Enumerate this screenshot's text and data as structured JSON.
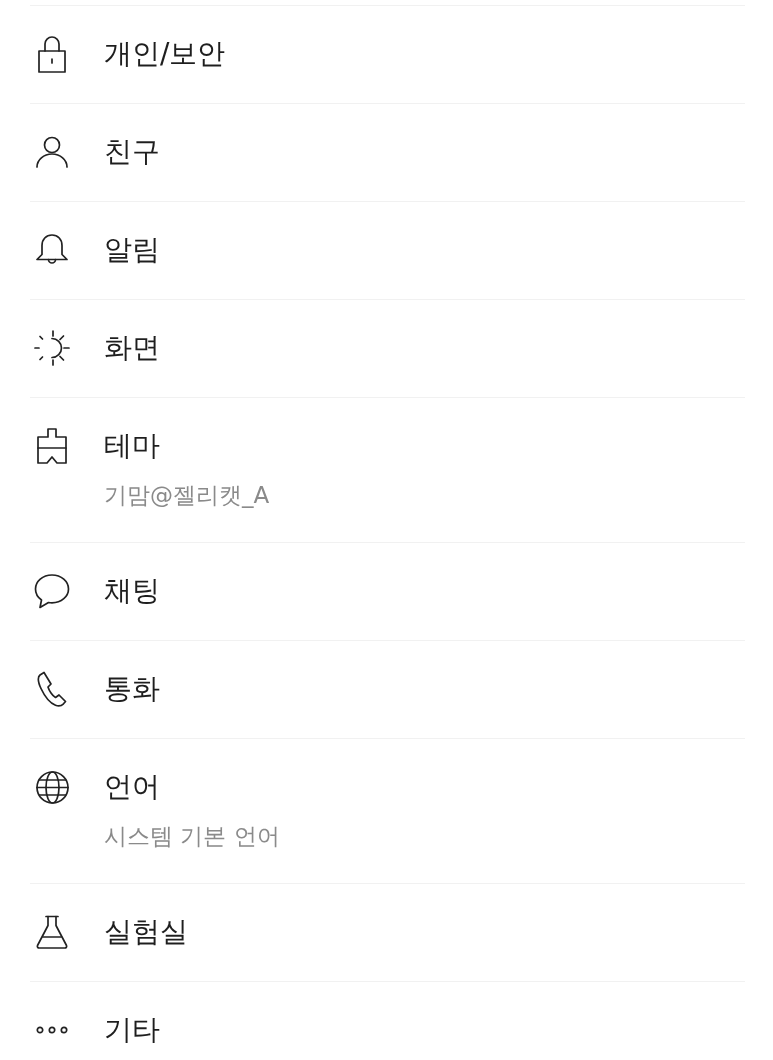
{
  "settings_items": [
    {
      "title": "개인/보안"
    },
    {
      "title": "친구"
    },
    {
      "title": "알림"
    },
    {
      "title": "화면"
    },
    {
      "title": "테마",
      "subtitle": "기맘@젤리캣_A"
    },
    {
      "title": "채팅"
    },
    {
      "title": "통화"
    },
    {
      "title": "언어",
      "subtitle": "시스템 기본 언어"
    },
    {
      "title": "실험실"
    },
    {
      "title": "기타"
    }
  ]
}
